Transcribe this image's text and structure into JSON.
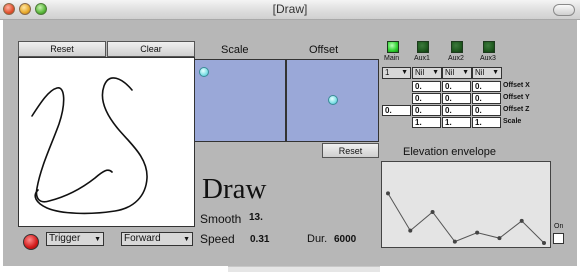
{
  "window": {
    "title": "[Draw]"
  },
  "drawing": {
    "reset_label": "Reset",
    "clear_label": "Clear"
  },
  "pads": {
    "scale_label": "Scale",
    "offset_label": "Offset",
    "reset_label": "Reset"
  },
  "outputs": {
    "leds": [
      {
        "label": "Main",
        "active": true
      },
      {
        "label": "Aux1",
        "active": false
      },
      {
        "label": "Aux2",
        "active": false
      },
      {
        "label": "Aux3",
        "active": false
      }
    ],
    "selects": [
      "1",
      "Nil",
      "Nil",
      "Nil"
    ],
    "rows": [
      {
        "label": "Offset X",
        "values": [
          "0.",
          "0.",
          "0."
        ]
      },
      {
        "label": "Offset Y",
        "values": [
          "0.",
          "0.",
          "0."
        ]
      },
      {
        "label": "Offset Z",
        "lead": "0.",
        "values": [
          "0.",
          "0.",
          "0."
        ]
      },
      {
        "label": "Scale",
        "values": [
          "1.",
          "1.",
          "1."
        ]
      }
    ]
  },
  "main": {
    "title": "Draw",
    "smooth_label": "Smooth",
    "smooth_value": "13.",
    "speed_label": "Speed",
    "speed_value": "0.31",
    "dur_label": "Dur.",
    "dur_value": "6000"
  },
  "envelope": {
    "title": "Elevation envelope",
    "on_label": "On",
    "points": [
      0.72,
      0.18,
      0.45,
      0.02,
      0.15,
      0.07,
      0.32,
      0.0
    ]
  },
  "controls": {
    "trigger_label": "Trigger",
    "forward_label": "Forward"
  },
  "colors": {
    "pad": "#9aa8d8",
    "panel": "#b7b7b7",
    "led_on": "#2fd12f",
    "led_off": "#1f5a1f",
    "record": "#d11a1a"
  }
}
